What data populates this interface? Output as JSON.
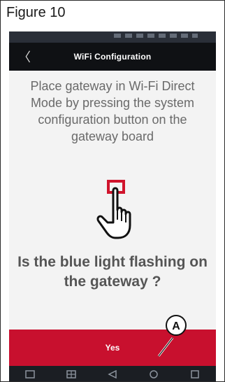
{
  "figure": {
    "caption": "Figure 10"
  },
  "appbar": {
    "title": "WiFi Configuration",
    "back_glyph": "〈"
  },
  "content": {
    "instruction": "Place gateway in Wi-Fi Direct Mode by pressing the system configuration button on the gateway board",
    "question": "Is the blue light flashing on the gateway ?"
  },
  "actions": {
    "yes_label": "Yes"
  },
  "callout": {
    "label": "A"
  },
  "icons": {
    "back": "chevron-left-icon",
    "illustration": "hand-pointer-press-icon",
    "nav": [
      "square-icon",
      "grid-icon",
      "triangle-back-icon",
      "circle-home-icon",
      "square-recents-icon"
    ]
  },
  "colors": {
    "appbar": "#0f1114",
    "button": "#c8102e",
    "statusbar": "#2a2f38",
    "navbar": "#1b1e23",
    "indicator": "#d0142c"
  }
}
